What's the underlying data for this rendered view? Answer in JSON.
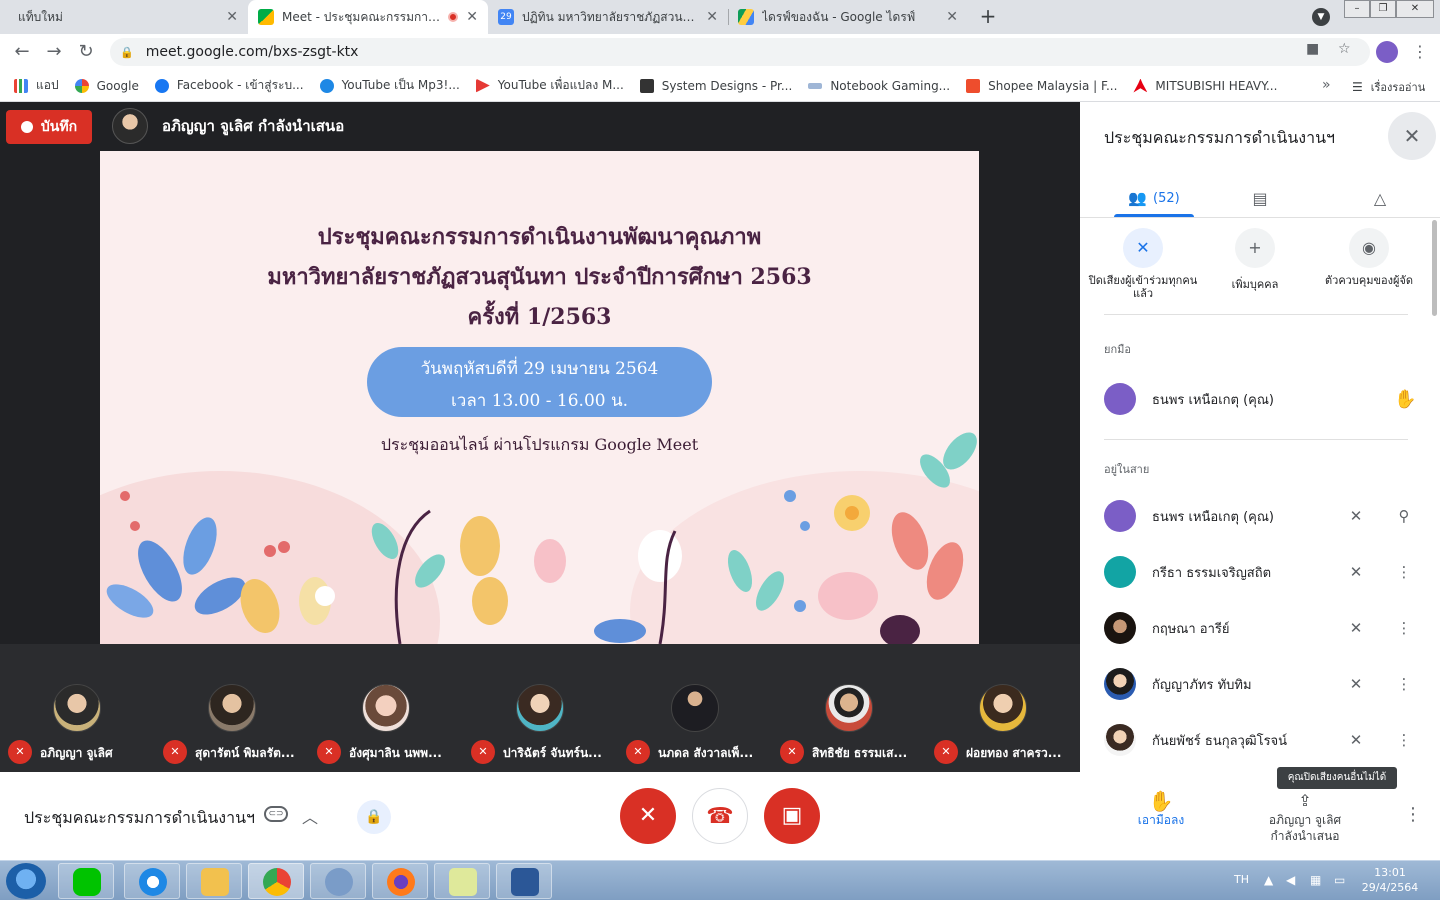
{
  "browser": {
    "tabs": [
      {
        "title": "แท็บใหม่"
      },
      {
        "title": "Meet - ประชุมคณะกรรมการดำเนิ"
      },
      {
        "title": "ปฏิทิน มหาวิทยาลัยราชภัฏสวนสุนันทา"
      },
      {
        "title": "ไดรฟ์ของฉัน - Google ไดรฟ์"
      }
    ],
    "url": "meet.google.com/bxs-zsgt-ktx",
    "bookmarks": [
      {
        "label": "แอป"
      },
      {
        "label": "Google"
      },
      {
        "label": "Facebook - เข้าสู่ระบ..."
      },
      {
        "label": "YouTube เป็น Mp3!..."
      },
      {
        "label": "YouTube เพื่อแปลง M..."
      },
      {
        "label": "System Designs - Pr..."
      },
      {
        "label": "Notebook Gaming..."
      },
      {
        "label": "Shopee Malaysia | F..."
      },
      {
        "label": "MITSUBISHI HEAVY..."
      }
    ],
    "bookmarks_more": "»",
    "reading_list": "เรื่องรออ่าน"
  },
  "meet": {
    "record_label": "บันทึก",
    "presenter_label": "อภิญญา จูเลิศ กำลังนำเสนอ",
    "slide": {
      "line1": "ประชุมคณะกรรมการดำเนินงานพัฒนาคุณภาพ",
      "line2": "มหาวิทยาลัยราชภัฏสวนสุนันทา ประจำปีการศึกษา 2563",
      "line3": "ครั้งที่ 1/2563",
      "date": "วันพฤหัสบดีที่ 29 เมษายน 2564",
      "time": "เวลา 13.00 - 16.00 น.",
      "online": "ประชุมออนไลน์ ผ่านโปรแกรม Google Meet"
    },
    "participants_strip": [
      {
        "name": "อภิญญา จูเลิศ"
      },
      {
        "name": "สุดารัตน์ พิมลรัต..."
      },
      {
        "name": "อังศุมาลิน นพพ..."
      },
      {
        "name": "ปาริฉัตร์ จันทร์น..."
      },
      {
        "name": "นภดล สังวาลเพ็..."
      },
      {
        "name": "สิทธิชัย ธรรมเส..."
      },
      {
        "name": "ฝอยทอง สาครว..."
      }
    ]
  },
  "panel": {
    "title": "ประชุมคณะกรรมการดำเนินงานฯ",
    "people_count": "(52)",
    "quick_actions": [
      {
        "label": "ปิดเสียงผู้เข้าร่วมทุกคนแล้ว"
      },
      {
        "label": "เพิ่มบุคคล"
      },
      {
        "label": "ตัวควบคุมของผู้จัด"
      }
    ],
    "raised_hand_label": "ยกมือ",
    "raised_hand_person": "ธนพร เหนือเกตุ (คุณ)",
    "in_call_label": "อยู่ในสาย",
    "in_call": [
      {
        "name": "ธนพร เหนือเกตุ (คุณ)"
      },
      {
        "name": "กรีธา ธรรมเจริญสถิต"
      },
      {
        "name": "กฤษณา อารีย์"
      },
      {
        "name": "กัญญาภัทร ทับทิม"
      },
      {
        "name": "กันยพัชร์ ธนกุลวุฒิโรจน์"
      }
    ]
  },
  "bottom": {
    "meeting_title": "ประชุมคณะกรรมการดำเนินงานฯ",
    "lower_hand_label": "เอามือลง",
    "presenting_line1": "อภิญญา จูเลิศ",
    "presenting_line2": "กำลังนำเสนอ",
    "tooltip": "คุณปิดเสียงคนอื่นไม่ได้"
  },
  "taskbar": {
    "lang": "TH",
    "time": "13:01",
    "date": "29/4/2564"
  },
  "colors": {
    "meet_red": "#d93025",
    "accent_blue": "#1a73e8",
    "stage_bg": "#202124",
    "slide_pill": "#6b9ee2"
  }
}
